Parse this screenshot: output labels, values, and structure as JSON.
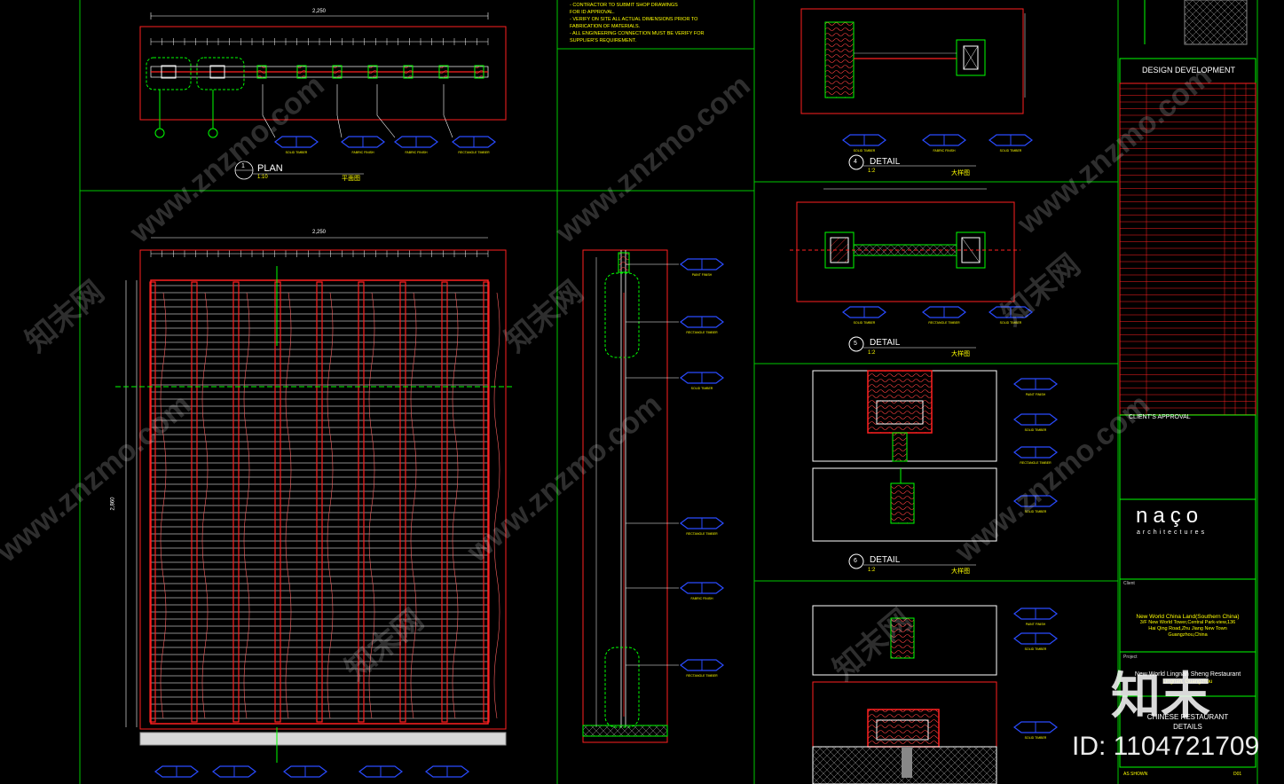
{
  "notes": [
    "- CONTRACTOR TO SUBMIT SHOP DRAWINGS",
    "  FOR ID APPROVAL.",
    "- VERIFY ON SITE ALL ACTUAL DIMENSIONS PRIOR TO",
    "  FABRICATION OF MATERIALS.",
    "- ALL ENGINEERING CONNECTION MUST BE VERIFY FOR",
    "  SUPPLIER'S REQUIREMENT."
  ],
  "views": {
    "plan": {
      "number": "1",
      "title": "PLAN",
      "scale": "1:10",
      "cn": "平面图",
      "overall_dim": "2,250"
    },
    "elevation": {
      "overall_dim": "2,250",
      "height_dim": "2,860"
    },
    "detail4": {
      "number": "4",
      "title": "DETAIL",
      "scale": "1:2",
      "cn": "大样图"
    },
    "detail5": {
      "number": "5",
      "title": "DETAIL",
      "scale": "1:2",
      "cn": "大样图"
    },
    "detail6": {
      "number": "6",
      "title": "DETAIL",
      "scale": "1:2",
      "cn": "大样图"
    }
  },
  "tags": {
    "solid_timber": "SOLID TIMBER",
    "fabric_finish": "FABRIC FINISH",
    "rectangle_timber": "RECTANGLE TIMBER",
    "paint_finish": "PAINT FINISH"
  },
  "title_block": {
    "stage": "DESIGN DEVELOPMENT",
    "approval": "CLIENT'S APPROVAL",
    "firm_logo": "naço",
    "firm_sub": "architectures",
    "client_label": "Client",
    "client": [
      "New World China Land(Southern China)",
      "3/F New World Tower,Central Park-view,136",
      "Hai Qing Road,Zhu Jiang New Town",
      "Guangzhou,China"
    ],
    "project_label": "Project",
    "project": [
      "New World Lingnan Sheng Restaurant",
      "Lingnan, Guangzhou"
    ],
    "drawing": [
      "CHINESE RESTAURANT",
      "DETAILS"
    ],
    "scale_label": "AS SHOWN",
    "sheet": "D01"
  },
  "watermark": {
    "site": "www.znzmo.com",
    "brand_cn": "知末网",
    "logo_cn": "知末",
    "id_text": "ID: 1104721709"
  },
  "colors": {
    "bg": "#000000",
    "frame": "#00ff00",
    "red": "#ff2020",
    "yellow": "#ffff00",
    "tag": "#0000ff",
    "white": "#ffffff"
  }
}
